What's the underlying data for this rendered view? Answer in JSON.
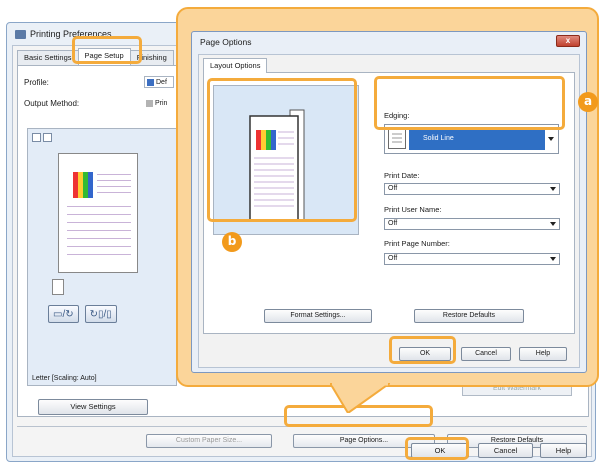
{
  "printing_preferences": {
    "title": "Printing Preferences",
    "tabs": [
      "Basic Settings",
      "Page Setup",
      "Finishing"
    ],
    "active_tab": "Page Setup",
    "profile_label": "Profile:",
    "output_method_label": "Output Method:",
    "profile_value": "Def",
    "output_method_value": "Prin",
    "preview_caption": "Letter [Scaling: Auto]",
    "view_settings_button": "View Settings",
    "obscured_button": "Edit Watermark",
    "custom_paper_size_button": "Custom Paper Size...",
    "page_options_button": "Page Options...",
    "restore_defaults_button": "Restore Defaults",
    "ok_button": "OK",
    "cancel_button": "Cancel",
    "help_button": "Help"
  },
  "page_options": {
    "title": "Page Options",
    "close_label": "x",
    "tab": "Layout Options",
    "edging_label": "Edging:",
    "edging_value": "Solid Line",
    "print_date_label": "Print Date:",
    "print_date_value": "Off",
    "print_user_name_label": "Print User Name:",
    "print_user_name_value": "Off",
    "print_page_number_label": "Print Page Number:",
    "print_page_number_value": "Off",
    "format_settings_button": "Format Settings...",
    "restore_defaults_button": "Restore Defaults",
    "ok_button": "OK",
    "cancel_button": "Cancel",
    "help_button": "Help"
  },
  "callouts": {
    "a": "a",
    "b": "b"
  },
  "colors": {
    "highlight": "#f4ab3c",
    "magnifier_fill": "#fbd59a",
    "selection_blue": "#2f6fc4"
  }
}
